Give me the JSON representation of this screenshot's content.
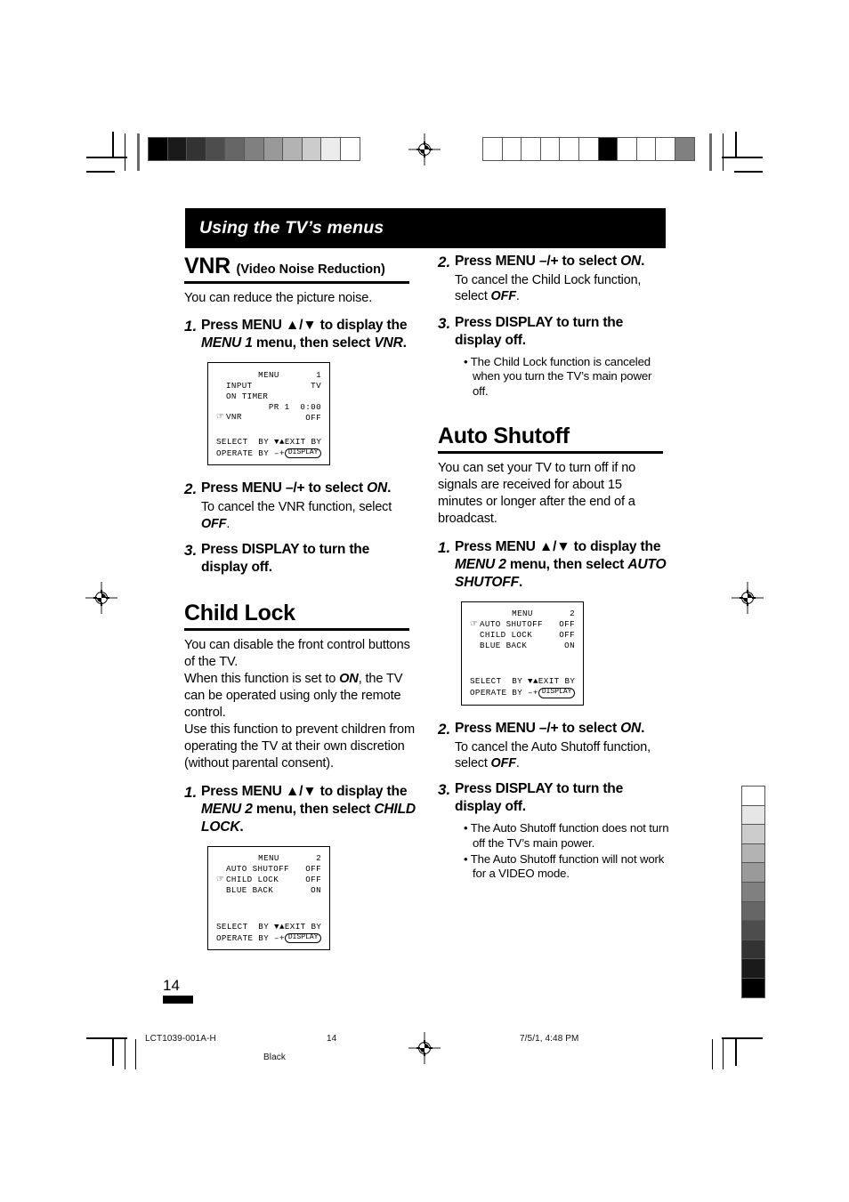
{
  "banner": {
    "title": "Using the TV’s menus"
  },
  "left_column": {
    "vnr": {
      "heading": "VNR",
      "heading_sub": "(Video Noise Reduction)",
      "intro": "You can reduce the picture noise.",
      "steps": [
        {
          "num": "1.",
          "lead_a": "Press MENU ",
          "lead_arrows": "▲/▼",
          "lead_b": " to display the ",
          "lead_em1": "MENU 1",
          "lead_c": " menu, then select ",
          "lead_em2": "VNR",
          "lead_d": "."
        },
        {
          "num": "2.",
          "lead_a": "Press MENU –/+ to select ",
          "lead_em1": "ON",
          "lead_d": ".",
          "sub_a": "To cancel the VNR function, select ",
          "sub_em": "OFF",
          "sub_b": "."
        },
        {
          "num": "3.",
          "lead_a": "Press DISPLAY to turn the display off."
        }
      ],
      "osd": {
        "title": "MENU",
        "title_num": "1",
        "rows": [
          {
            "cursor": "",
            "key": "INPUT",
            "value": "TV"
          },
          {
            "cursor": "",
            "key": "ON TIMER",
            "value": ""
          },
          {
            "cursor": "",
            "key": "",
            "value": "PR 1  0:00"
          },
          {
            "cursor": "☞",
            "key": "VNR",
            "value": "OFF"
          }
        ],
        "footer_select": "SELECT  BY ▼▲",
        "footer_operate": "OPERATE BY –+",
        "footer_exit": "EXIT BY",
        "footer_button": "DISPLAY"
      }
    },
    "child_lock": {
      "heading": "Child Lock",
      "intro_lines": [
        "You can disable the front control buttons of the TV.",
        "When this function is set to ON, the TV can be operated using only the remote control.",
        "Use this function to prevent children from operating the TV at their own discretion (without parental consent)."
      ],
      "intro_1a": "You can disable the front control buttons of the TV.",
      "intro_2a": "When this function is set to ",
      "intro_2em": "ON",
      "intro_2b": ", the TV can be operated using only the remote control.",
      "intro_3a": "Use this function to prevent children from operating the TV at their own discretion (without parental consent).",
      "step1": {
        "num": "1.",
        "lead_a": "Press MENU ",
        "lead_arrows": "▲/▼",
        "lead_b": " to display the ",
        "lead_em1": "MENU 2",
        "lead_c": " menu, then select ",
        "lead_em2": "CHILD LOCK",
        "lead_d": "."
      },
      "osd": {
        "title": "MENU",
        "title_num": "2",
        "rows": [
          {
            "cursor": "",
            "key": "AUTO SHUTOFF",
            "value": "OFF"
          },
          {
            "cursor": "☞",
            "key": "CHILD LOCK",
            "value": "OFF"
          },
          {
            "cursor": "",
            "key": "BLUE BACK",
            "value": "ON"
          }
        ],
        "footer_select": "SELECT  BY ▼▲",
        "footer_operate": "OPERATE BY –+",
        "footer_exit": "EXIT BY",
        "footer_button": "DISPLAY"
      }
    }
  },
  "right_column": {
    "child_lock_cont": {
      "step2": {
        "num": "2.",
        "lead_a": "Press MENU –/+ to select ",
        "lead_em1": "ON",
        "lead_d": ".",
        "sub_a": "To cancel the Child Lock function, select ",
        "sub_em": "OFF",
        "sub_b": "."
      },
      "step3": {
        "num": "3.",
        "lead_a": "Press DISPLAY to turn the display off."
      },
      "notes": [
        "The Child Lock function is canceled when you turn the TV’s main power off."
      ]
    },
    "auto_shutoff": {
      "heading": "Auto Shutoff",
      "intro": "You can set your TV to turn off if no signals are received for about 15 minutes or longer after the end of a broadcast.",
      "step1": {
        "num": "1.",
        "lead_a": "Press MENU ",
        "lead_arrows": "▲/▼",
        "lead_b": " to display the ",
        "lead_em1": "MENU 2",
        "lead_c": " menu, then select ",
        "lead_em2": "AUTO SHUTOFF",
        "lead_d": "."
      },
      "osd": {
        "title": "MENU",
        "title_num": "2",
        "rows": [
          {
            "cursor": "☞",
            "key": "AUTO SHUTOFF",
            "value": "OFF"
          },
          {
            "cursor": "",
            "key": "CHILD LOCK",
            "value": "OFF"
          },
          {
            "cursor": "",
            "key": "BLUE BACK",
            "value": "ON"
          }
        ],
        "footer_select": "SELECT  BY ▼▲",
        "footer_operate": "OPERATE BY –+",
        "footer_exit": "EXIT BY",
        "footer_button": "DISPLAY"
      },
      "step2": {
        "num": "2.",
        "lead_a": "Press MENU –/+ to select ",
        "lead_em1": "ON",
        "lead_d": ".",
        "sub_a": "To cancel the Auto Shutoff function, select ",
        "sub_em": "OFF",
        "sub_b": "."
      },
      "step3": {
        "num": "3.",
        "lead_a": "Press DISPLAY to turn the display off."
      },
      "notes": [
        "The Auto Shutoff function does not turn off the TV’s main power.",
        "The Auto Shutoff function will not work for a VIDEO mode."
      ]
    }
  },
  "page_number": "14",
  "footer": {
    "doc_code": "LCT1039-001A-H",
    "page": "14",
    "plate": "Black",
    "timestamp": "7/5/1, 4:48 PM"
  },
  "print_marks": {
    "top_left_strip": [
      "#000000",
      "#1a1a1a",
      "#333333",
      "#4d4d4d",
      "#666666",
      "#808080",
      "#999999",
      "#b3b3b3",
      "#cccccc",
      "#ececec",
      "#ffffff"
    ],
    "top_right_strip": [
      "#ffffff",
      "#ffffff",
      "#ffffff",
      "#ffffff",
      "#ffffff",
      "#ffffff",
      "#000000",
      "#ffffff",
      "#ffffff",
      "#ffffff",
      "#808080"
    ],
    "right_vertical_strip": [
      "#ffffff",
      "#e6e6e6",
      "#cccccc",
      "#b3b3b3",
      "#9a9a9a",
      "#808080",
      "#666666",
      "#4d4d4d",
      "#333333",
      "#1a1a1a",
      "#000000"
    ]
  }
}
